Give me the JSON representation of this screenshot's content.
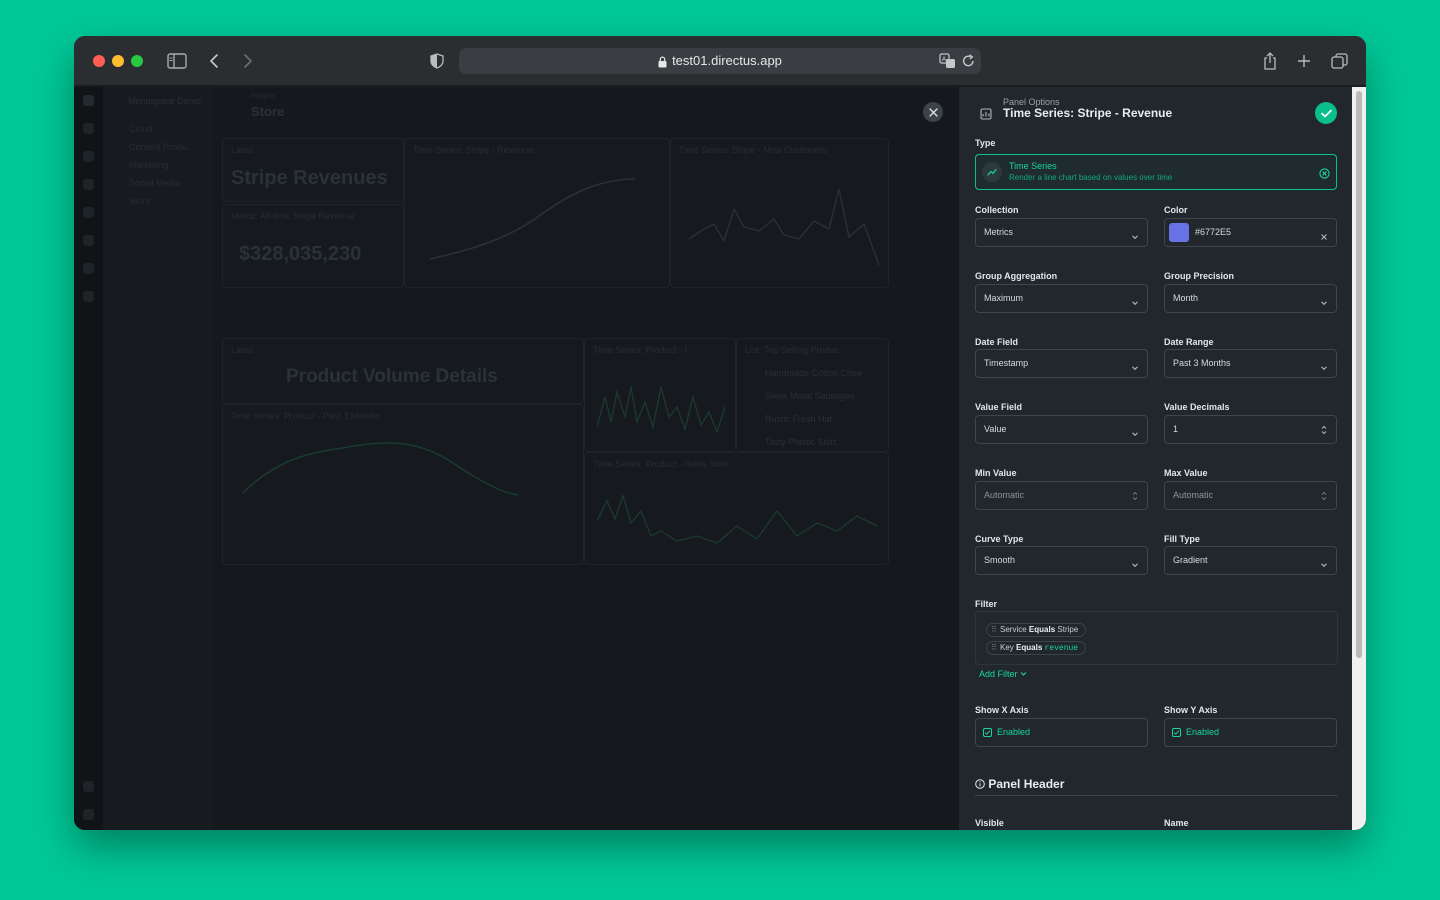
{
  "browser": {
    "url": "test01.directus.app"
  },
  "background_app": {
    "project_name": "Monospace Demo",
    "nav_items": [
      "Cloud",
      "Content Produ...",
      "Marketing",
      "Social Media",
      "Store"
    ],
    "breadcrumb_small": "Insights",
    "breadcrumb_title": "Store",
    "panels": {
      "label_1": "Label",
      "stripe_revenues": "Stripe Revenues",
      "metric_label": "Metric: All-time Stripe Revenue",
      "metric_value": "$328,035,230",
      "ts_revenue": "Time Series: Stripe - Revenue",
      "ts_customers": "Time Series: Stripe - New Customers",
      "label_2": "Label",
      "product_volume": "Product Volume Details",
      "ts_product_1": "Time Series: Product - I",
      "list_top": "List: Top Selling Produc",
      "list_items": [
        "Handmade Cotton Chee",
        "Sleek Metal Sausages",
        "Rustic Fresh Hat",
        "Tasty Plastic Shirt"
      ],
      "ts_product_3m": "Time Series: Product - Past 3 Months",
      "ts_items_sold": "Time Series: Product - Items Sold"
    }
  },
  "drawer": {
    "subtitle": "Panel Options",
    "title": "Time Series: Stripe - Revenue",
    "type_label": "Type",
    "type_name": "Time Series",
    "type_desc": "Render a line chart based on values over time",
    "collection_label": "Collection",
    "collection_value": "Metrics",
    "color_label": "Color",
    "color_value": "#6772E5",
    "color_hex": "#6772E5",
    "group_aggregation_label": "Group Aggregation",
    "group_aggregation_value": "Maximum",
    "group_precision_label": "Group Precision",
    "group_precision_value": "Month",
    "date_field_label": "Date Field",
    "date_field_value": "Timestamp",
    "date_range_label": "Date Range",
    "date_range_value": "Past 3 Months",
    "value_field_label": "Value Field",
    "value_field_value": "Value",
    "value_decimals_label": "Value Decimals",
    "value_decimals_value": "1",
    "min_value_label": "Min Value",
    "min_value_placeholder": "Automatic",
    "max_value_label": "Max Value",
    "max_value_placeholder": "Automatic",
    "curve_type_label": "Curve Type",
    "curve_type_value": "Smooth",
    "fill_type_label": "Fill Type",
    "fill_type_value": "Gradient",
    "filter_label": "Filter",
    "filters": [
      {
        "field": "Service",
        "op": "Equals",
        "value": "Stripe"
      },
      {
        "field": "Key",
        "op": "Equals",
        "value": "revenue"
      }
    ],
    "add_filter": "Add Filter",
    "show_x_label": "Show X Axis",
    "show_x_value": "Enabled",
    "show_y_label": "Show Y Axis",
    "show_y_value": "Enabled",
    "panel_header_section": "Panel Header",
    "visible_label": "Visible",
    "name_label": "Name"
  }
}
